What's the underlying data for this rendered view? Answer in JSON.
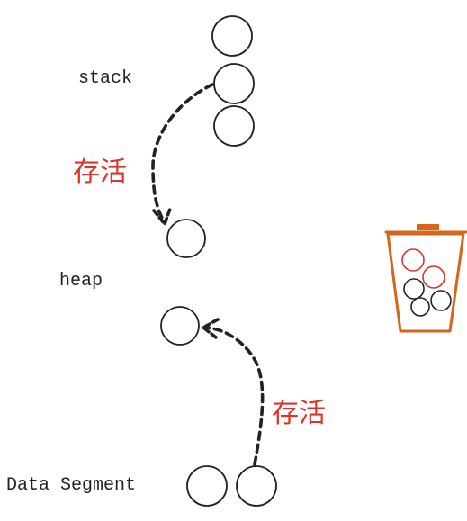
{
  "labels": {
    "stack": "stack",
    "heap": "heap",
    "data_segment": "Data Segment",
    "alive_top": "存活",
    "alive_bottom": "存活"
  },
  "colors": {
    "outline": "#222222",
    "alive_text": "#d9352c",
    "bin": "#d5661c",
    "bin_ball_red": "#d9352c"
  },
  "icons": {
    "bin": "trash-bin-icon",
    "object": "circle-node"
  }
}
